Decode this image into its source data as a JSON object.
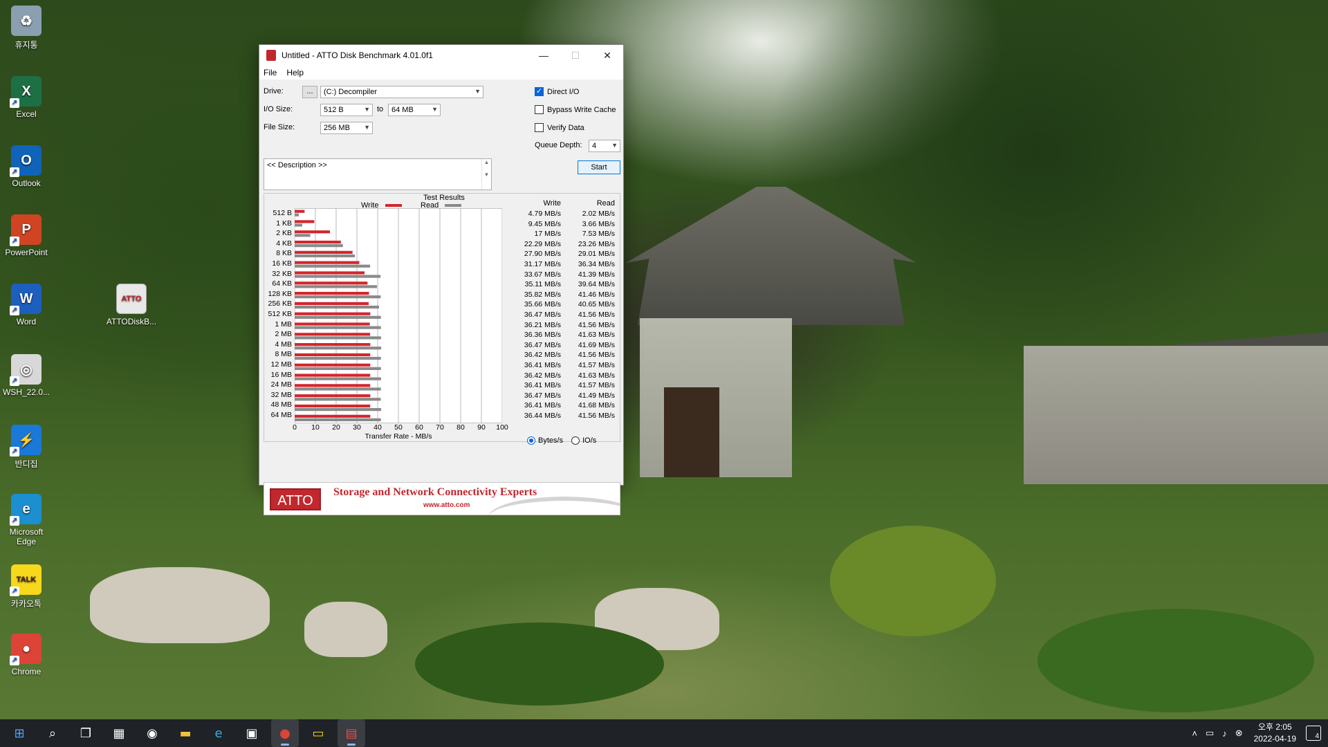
{
  "desktop": {
    "icons": [
      {
        "label": "휴지통",
        "glyph": "♻",
        "color": "#8aa0b0",
        "icon": "recycle-bin-icon"
      },
      {
        "label": "Excel",
        "glyph": "X",
        "color": "#1d7044",
        "icon": "excel-icon"
      },
      {
        "label": "Outlook",
        "glyph": "O",
        "color": "#0f63b8",
        "icon": "outlook-icon"
      },
      {
        "label": "PowerPoint",
        "glyph": "P",
        "color": "#d04423",
        "icon": "powerpoint-icon"
      },
      {
        "label": "Word",
        "glyph": "W",
        "color": "#1d5fbf",
        "icon": "word-icon"
      },
      {
        "label": "WSH_22.0...",
        "glyph": "◎",
        "color": "#d8d8d8",
        "icon": "disc-image-icon"
      },
      {
        "label": "반디집",
        "glyph": "⚡",
        "color": "#1a78d8",
        "icon": "bandizip-icon"
      },
      {
        "label": "Microsoft Edge",
        "glyph": "e",
        "color": "#1b8fd0",
        "icon": "edge-icon"
      },
      {
        "label": "카카오톡",
        "glyph": "TALK",
        "color": "#f7d81b",
        "icon": "kakaotalk-icon"
      },
      {
        "label": "Chrome",
        "glyph": "●",
        "color": "#db4437",
        "icon": "chrome-icon"
      }
    ],
    "atto_icon": {
      "label": "ATTODiskB...",
      "glyph": "ATTO"
    }
  },
  "window": {
    "title": "Untitled - ATTO Disk Benchmark 4.01.0f1",
    "menu": [
      "File",
      "Help"
    ],
    "drive_label": "Drive:",
    "drive_browse": "...",
    "drive_value": "(C:) Decompiler",
    "io_size_label": "I/O Size:",
    "io_from": "512 B",
    "io_to_label": "to",
    "io_to": "64 MB",
    "file_size_label": "File Size:",
    "file_size": "256 MB",
    "direct_io": {
      "label": "Direct I/O",
      "checked": true
    },
    "bypass_cache": {
      "label": "Bypass Write Cache",
      "checked": false
    },
    "verify_data": {
      "label": "Verify Data",
      "checked": false
    },
    "queue_depth_label": "Queue Depth:",
    "queue_depth": "4",
    "start_label": "Start",
    "description": "<< Description >>",
    "results_title": "Test Results",
    "legend_write": "Write",
    "legend_read": "Read",
    "col_write": "Write",
    "col_read": "Read",
    "x_title": "Transfer Rate - MB/s",
    "radio_bytes": "Bytes/s",
    "radio_io": "IO/s",
    "banner_logo": "ATTO",
    "banner_tagline": "Storage and Network Connectivity Experts",
    "banner_url": "www.atto.com",
    "write_color": "#d3262c",
    "read_color": "#8a8a8a"
  },
  "chart_data": {
    "type": "bar",
    "orientation": "horizontal",
    "categories": [
      "512 B",
      "1 KB",
      "2 KB",
      "4 KB",
      "8 KB",
      "16 KB",
      "32 KB",
      "64 KB",
      "128 KB",
      "256 KB",
      "512 KB",
      "1 MB",
      "2 MB",
      "4 MB",
      "8 MB",
      "12 MB",
      "16 MB",
      "24 MB",
      "32 MB",
      "48 MB",
      "64 MB"
    ],
    "series": [
      {
        "name": "Write",
        "values": [
          4.79,
          9.45,
          17,
          22.29,
          27.9,
          31.17,
          33.67,
          35.11,
          35.82,
          35.66,
          36.47,
          36.21,
          36.36,
          36.47,
          36.42,
          36.41,
          36.42,
          36.41,
          36.47,
          36.41,
          36.44
        ]
      },
      {
        "name": "Read",
        "values": [
          2.02,
          3.66,
          7.53,
          23.26,
          29.01,
          36.34,
          41.39,
          39.64,
          41.46,
          40.65,
          41.56,
          41.56,
          41.63,
          41.69,
          41.56,
          41.57,
          41.63,
          41.57,
          41.49,
          41.68,
          41.56
        ]
      }
    ],
    "write_text": [
      "4.79 MB/s",
      "9.45 MB/s",
      "17 MB/s",
      "22.29 MB/s",
      "27.90 MB/s",
      "31.17 MB/s",
      "33.67 MB/s",
      "35.11 MB/s",
      "35.82 MB/s",
      "35.66 MB/s",
      "36.47 MB/s",
      "36.21 MB/s",
      "36.36 MB/s",
      "36.47 MB/s",
      "36.42 MB/s",
      "36.41 MB/s",
      "36.42 MB/s",
      "36.41 MB/s",
      "36.47 MB/s",
      "36.41 MB/s",
      "36.44 MB/s"
    ],
    "read_text": [
      "2.02 MB/s",
      "3.66 MB/s",
      "7.53 MB/s",
      "23.26 MB/s",
      "29.01 MB/s",
      "36.34 MB/s",
      "41.39 MB/s",
      "39.64 MB/s",
      "41.46 MB/s",
      "40.65 MB/s",
      "41.56 MB/s",
      "41.56 MB/s",
      "41.63 MB/s",
      "41.69 MB/s",
      "41.56 MB/s",
      "41.57 MB/s",
      "41.63 MB/s",
      "41.57 MB/s",
      "41.49 MB/s",
      "41.68 MB/s",
      "41.56 MB/s"
    ],
    "xticks": [
      0,
      10,
      20,
      30,
      40,
      50,
      60,
      70,
      80,
      90,
      100
    ],
    "xlim": [
      0,
      100
    ],
    "xlabel": "Transfer Rate - MB/s",
    "title": "Test Results",
    "grid": true,
    "legend": "top"
  },
  "taskbar": {
    "items": [
      {
        "name": "start-button",
        "glyph": "⊞"
      },
      {
        "name": "search-button",
        "glyph": "⌕"
      },
      {
        "name": "task-view-button",
        "glyph": "❐"
      },
      {
        "name": "widgets-button",
        "glyph": "▦"
      },
      {
        "name": "chat-button",
        "glyph": "◉"
      },
      {
        "name": "file-explorer-button",
        "glyph": "▬"
      },
      {
        "name": "edge-button",
        "glyph": "e"
      },
      {
        "name": "store-button",
        "glyph": "▣"
      },
      {
        "name": "chrome-button",
        "glyph": "●"
      },
      {
        "name": "kakaotalk-button",
        "glyph": "▭"
      },
      {
        "name": "atto-button",
        "glyph": "▤"
      }
    ],
    "time": "오후 2:05",
    "date": "2022-04-19",
    "notifications": "4"
  }
}
